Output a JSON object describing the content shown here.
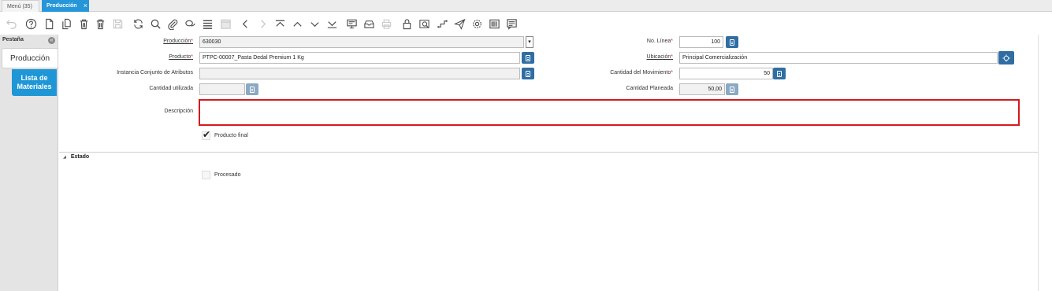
{
  "tabs": {
    "menu_label": "Menú (35)",
    "active_label": "Producción",
    "close_glyph": "×"
  },
  "left_panel": {
    "header": "Pestaña",
    "collapse_glyph": "«",
    "tab_production": "Producción",
    "tab_bom_line1": "Lista de",
    "tab_bom_line2": "Materiales"
  },
  "form": {
    "production_label": "Producción",
    "production_value": "630030",
    "product_label": "Producto",
    "product_value": "PTPC-00007_Pasta Dedal Premium 1 Kg",
    "attribute_set_label": "Instancia Conjunto de Atributos",
    "attribute_set_value": "",
    "qty_used_label": "Cantidad utilizada",
    "qty_used_value": "",
    "description_label": "Descripción",
    "description_value": "",
    "end_product_label": "Producto final",
    "end_product_checked": true,
    "line_no_label": "No. Línea",
    "line_no_value": "100",
    "location_label": "Ubicación",
    "location_value": "Principal Comercialización",
    "movement_qty_label": "Cantidad del Movimiento",
    "movement_qty_value": "50",
    "planned_qty_label": "Cantidad Planeada",
    "planned_qty_value": "50,00",
    "required_mark": "*",
    "dropdown_glyph": "▾"
  },
  "status_section": {
    "title": "Estado",
    "processed_label": "Procesado",
    "processed_checked": false
  },
  "toolbar_icons": [
    "undo-icon",
    "help-icon",
    "new-record-icon",
    "copy-record-icon",
    "delete-icon",
    "delete-selection-icon",
    "save-icon",
    "refresh-icon",
    "find-icon",
    "attachment-icon",
    "chat-icon",
    "grid-toggle-icon",
    "calendar-icon",
    "previous-icon",
    "next-icon",
    "first-record-icon",
    "parent-record-icon",
    "detail-record-icon",
    "last-record-icon",
    "report-icon",
    "archive-icon",
    "print-icon",
    "lock-icon",
    "zoom-across-icon",
    "workflow-icon",
    "send-icon",
    "process-icon",
    "product-info-icon",
    "notes-icon"
  ],
  "colors": {
    "accent": "#2596d8",
    "button": "#2f6ea3",
    "required": "#d32f2f",
    "description_border": "#d7191c"
  }
}
